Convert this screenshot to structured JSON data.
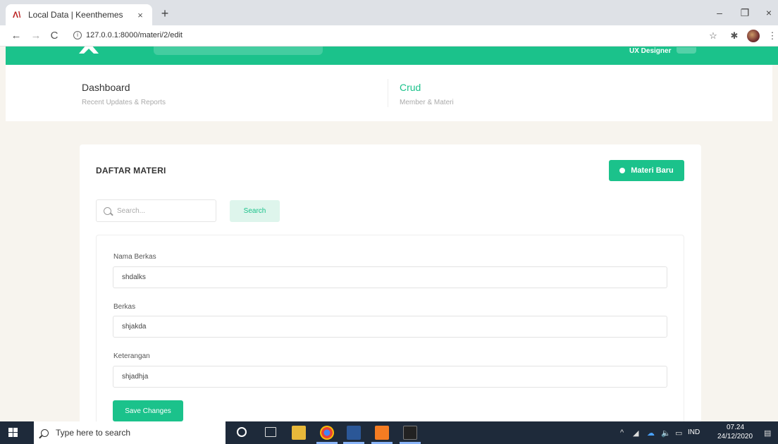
{
  "browser": {
    "tab_title": "Local Data | Keenthemes",
    "url": "127.0.0.1:8000/materi/2/edit"
  },
  "header": {
    "user_role": "UX Designer"
  },
  "subheader": {
    "items": [
      {
        "title": "Dashboard",
        "desc": "Recent Updates & Reports"
      },
      {
        "title": "Crud",
        "desc": "Member & Materi"
      }
    ]
  },
  "card": {
    "title": "DAFTAR MATERI",
    "new_button": "Materi Baru",
    "search_placeholder": "Search...",
    "search_button": "Search"
  },
  "form": {
    "fields": [
      {
        "label": "Nama Berkas",
        "value": "shdalks"
      },
      {
        "label": "Berkas",
        "value": "shjakda"
      },
      {
        "label": "Keterangan",
        "value": "shjadhja"
      }
    ],
    "save_button": "Save Changes"
  },
  "taskbar": {
    "search_placeholder": "Type here to search",
    "language": "IND",
    "time": "07.24",
    "date": "24/12/2020"
  },
  "colors": {
    "accent": "#1bc28b",
    "page_bg": "#f7f4ee",
    "taskbar": "#1e2a3a"
  }
}
